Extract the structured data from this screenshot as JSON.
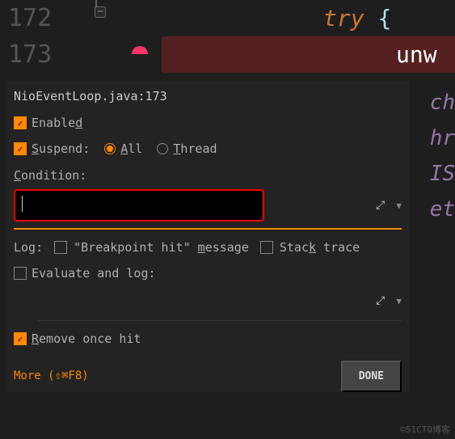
{
  "editor": {
    "lines": [
      {
        "num": "172",
        "code_kw": "try",
        "code_brace": "{"
      },
      {
        "num": "173",
        "code_white": "unw"
      }
    ],
    "fold_glyph": "−",
    "right_fragments": [
      "ch",
      "hr",
      " ",
      " ",
      "IS",
      "et"
    ]
  },
  "popup": {
    "title": "NioEventLoop.java:173",
    "enabled": {
      "pre": "Enable",
      "mn": "d"
    },
    "suspend": {
      "mn": "S",
      "post": "uspend:"
    },
    "opt_all": {
      "mn": "A",
      "post": "ll"
    },
    "opt_thread": {
      "mn": "T",
      "post": "hread"
    },
    "condition": {
      "mn": "C",
      "post": "ondition:"
    },
    "log_label": "Log:",
    "bp_hit": {
      "q1": "\"Breakpoint hit\" ",
      "mn": "m",
      "post": "essage"
    },
    "stack": {
      "pre": "Stac",
      "mn": "k",
      "post": " trace"
    },
    "eval": "Evaluate and log:",
    "remove": {
      "mn": "R",
      "post": "emove once hit"
    },
    "more": "More (⇧⌘F8)",
    "done": "DONE"
  },
  "watermark": "©51CTO博客"
}
